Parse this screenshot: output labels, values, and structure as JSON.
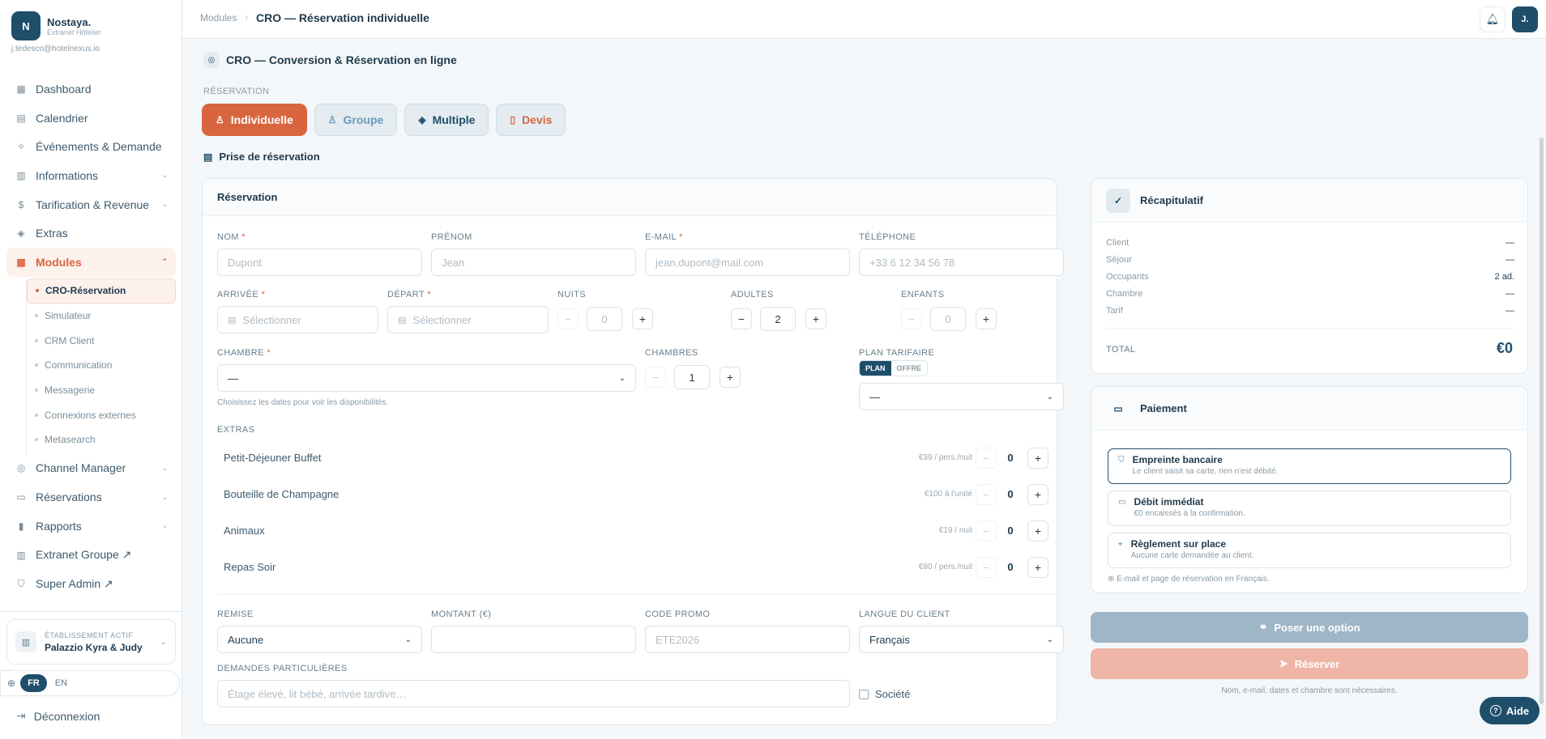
{
  "brand": {
    "logo_letter": "N",
    "name": "Nostaya.",
    "subtitle": "Extranet Hôtelier",
    "user_email": "j.tedesco@hotelnexus.io"
  },
  "nav": {
    "dashboard": "Dashboard",
    "calendrier": "Calendrier",
    "evenements": "Événements & Demande",
    "informations": "Informations",
    "tarification": "Tarification & Revenue",
    "extras": "Extras",
    "modules": "Modules",
    "modules_sub": [
      "CRO-Réservation",
      "Simulateur",
      "CRM Client",
      "Communication",
      "Messagerie",
      "Connexions externes",
      "Metasearch"
    ],
    "channel_manager": "Channel Manager",
    "reservations": "Réservations",
    "rapports": "Rapports",
    "extranet_groupe": "Extranet Groupe ↗",
    "super_admin": "Super Admin ↗"
  },
  "establishment": {
    "label": "ÉTABLISSEMENT ACTIF",
    "name": "Palazzio Kyra & Judy"
  },
  "language_switch": {
    "active": "FR",
    "other": "EN"
  },
  "logout_label": "Déconnexion",
  "breadcrumb": {
    "root": "Modules",
    "current": "CRO — Réservation individuelle"
  },
  "avatar_initial": "J.",
  "page": {
    "title": "CRO — Conversion & Réservation en ligne",
    "mode_label": "RÉSERVATION",
    "modes": [
      "Individuelle",
      "Groupe",
      "Multiple",
      "Devis"
    ],
    "section_label": "Prise de réservation"
  },
  "form": {
    "card_title": "Réservation",
    "nom": {
      "label": "NOM",
      "placeholder": "Dupont"
    },
    "prenom": {
      "label": "PRÉNOM",
      "placeholder": "Jean"
    },
    "email": {
      "label": "E-MAIL",
      "placeholder": "jean.dupont@mail.com"
    },
    "telephone": {
      "label": "TÉLÉPHONE",
      "placeholder": "+33 6 12 34 56 78"
    },
    "arrivee": {
      "label": "ARRIVÉE",
      "placeholder": "Sélectionner"
    },
    "depart": {
      "label": "DÉPART",
      "placeholder": "Sélectionner"
    },
    "nuits": {
      "label": "NUITS",
      "value": "0"
    },
    "adultes": {
      "label": "ADULTES",
      "value": "2"
    },
    "enfants": {
      "label": "ENFANTS",
      "value": "0"
    },
    "chambre": {
      "label": "CHAMBRE",
      "value": "—",
      "help": "Choisissez les dates pour voir les disponibilités."
    },
    "chambres": {
      "label": "CHAMBRES",
      "value": "1"
    },
    "plan_tarifaire": {
      "label": "PLAN TARIFAIRE",
      "toggle_on": "PLAN",
      "toggle_off": "OFFRE",
      "value": "—"
    },
    "extras_label": "EXTRAS",
    "extras": [
      {
        "name": "Petit-Déjeuner Buffet",
        "price": "€39 / pers./nuit",
        "qty": "0"
      },
      {
        "name": "Bouteille de Champagne",
        "price": "€100 à l'unité",
        "qty": "0"
      },
      {
        "name": "Animaux",
        "price": "€19 / nuit",
        "qty": "0"
      },
      {
        "name": "Repas Soir",
        "price": "€80 / pers./nuit",
        "qty": "0"
      }
    ],
    "remise": {
      "label": "REMISE",
      "value": "Aucune"
    },
    "montant": {
      "label": "MONTANT (€)",
      "value": ""
    },
    "code_promo": {
      "label": "CODE PROMO",
      "placeholder": "ETE2026"
    },
    "langue": {
      "label": "LANGUE DU CLIENT",
      "value": "Français"
    },
    "demandes": {
      "label": "DEMANDES PARTICULIÈRES",
      "placeholder": "Étage élevé, lit bébé, arrivée tardive…"
    },
    "societe_label": "Société"
  },
  "recap": {
    "title": "Récapitulatif",
    "rows": [
      {
        "label": "Client",
        "value": "—"
      },
      {
        "label": "Séjour",
        "value": "—"
      },
      {
        "label": "Occupants",
        "value": "2 ad."
      },
      {
        "label": "Chambre",
        "value": "—"
      },
      {
        "label": "Tarif",
        "value": "—"
      }
    ],
    "total_label": "TOTAL",
    "total_value": "€0"
  },
  "payment": {
    "title": "Paiement",
    "options": [
      {
        "title": "Empreinte bancaire",
        "desc": "Le client saisit sa carte, rien n'est débité."
      },
      {
        "title": "Débit immédiat",
        "desc": "€0 encaissés à la confirmation."
      },
      {
        "title": "Règlement sur place",
        "desc": "Aucune carte demandée au client."
      }
    ],
    "note": "E-mail et page de réservation en Français."
  },
  "actions": {
    "option_label": "Poser une option",
    "reserve_label": "Réserver",
    "footnote": "Nom, e-mail, dates et chambre sont nécessaires."
  },
  "help_label": "Aide",
  "colors": {
    "primary": "#1f4e6b",
    "accent": "#d9653f"
  }
}
